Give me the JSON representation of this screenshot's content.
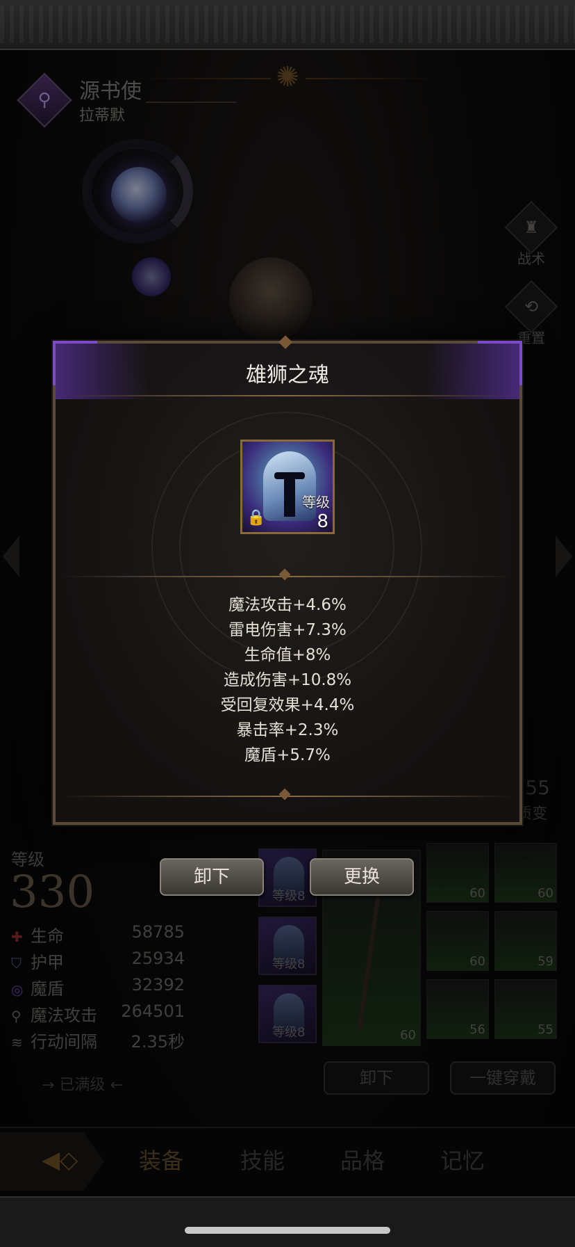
{
  "header": {
    "class_name": "源书使",
    "character_name": "拉蒂默",
    "class_icon": "staff-emblem-icon"
  },
  "side_buttons": [
    {
      "label": "战术",
      "icon": "tactics-icon"
    },
    {
      "label": "重置",
      "icon": "reset-icon"
    }
  ],
  "evolve": {
    "value": "55",
    "label": "质变"
  },
  "stats_panel": {
    "level_label": "等级",
    "level_value": "330",
    "stats": [
      {
        "icon": "health-icon",
        "label": "生命",
        "value": "58785"
      },
      {
        "icon": "armor-icon",
        "label": "护甲",
        "value": "25934"
      },
      {
        "icon": "magic-shield-icon",
        "label": "魔盾",
        "value": "32392"
      },
      {
        "icon": "magic-attack-icon",
        "label": "魔法攻击",
        "value": "264501"
      },
      {
        "icon": "action-interval-icon",
        "label": "行动间隔",
        "value": "2.35秒"
      }
    ],
    "maxed_text": "已满级"
  },
  "equipment_slots": {
    "soul_slots": [
      {
        "level_text": "等级8"
      },
      {
        "level_text": "等级8"
      },
      {
        "level_text": "等级8"
      }
    ],
    "weapon_level": "60",
    "gear_levels": [
      "60",
      "60",
      "60",
      "59",
      "56",
      "55"
    ]
  },
  "bottom_buttons": {
    "unequip": "卸下",
    "equip_all": "一键穿戴"
  },
  "tabs": {
    "items": [
      "装备",
      "技能",
      "品格",
      "记忆"
    ],
    "active_index": 0
  },
  "modal": {
    "title": "雄狮之魂",
    "item_level_label": "等级",
    "item_level_value": "8",
    "locked": true,
    "stats": [
      "魔法攻击+4.6%",
      "雷电伤害+7.3%",
      "生命值+8%",
      "造成伤害+10.8%",
      "受回复效果+4.4%",
      "暴击率+2.3%",
      "魔盾+5.7%"
    ],
    "actions": {
      "unequip": "卸下",
      "replace": "更换"
    }
  },
  "colors": {
    "accent_purple": "#7a4ac8",
    "modal_border": "#5a4a3a",
    "button_bg": "#4e4944"
  }
}
